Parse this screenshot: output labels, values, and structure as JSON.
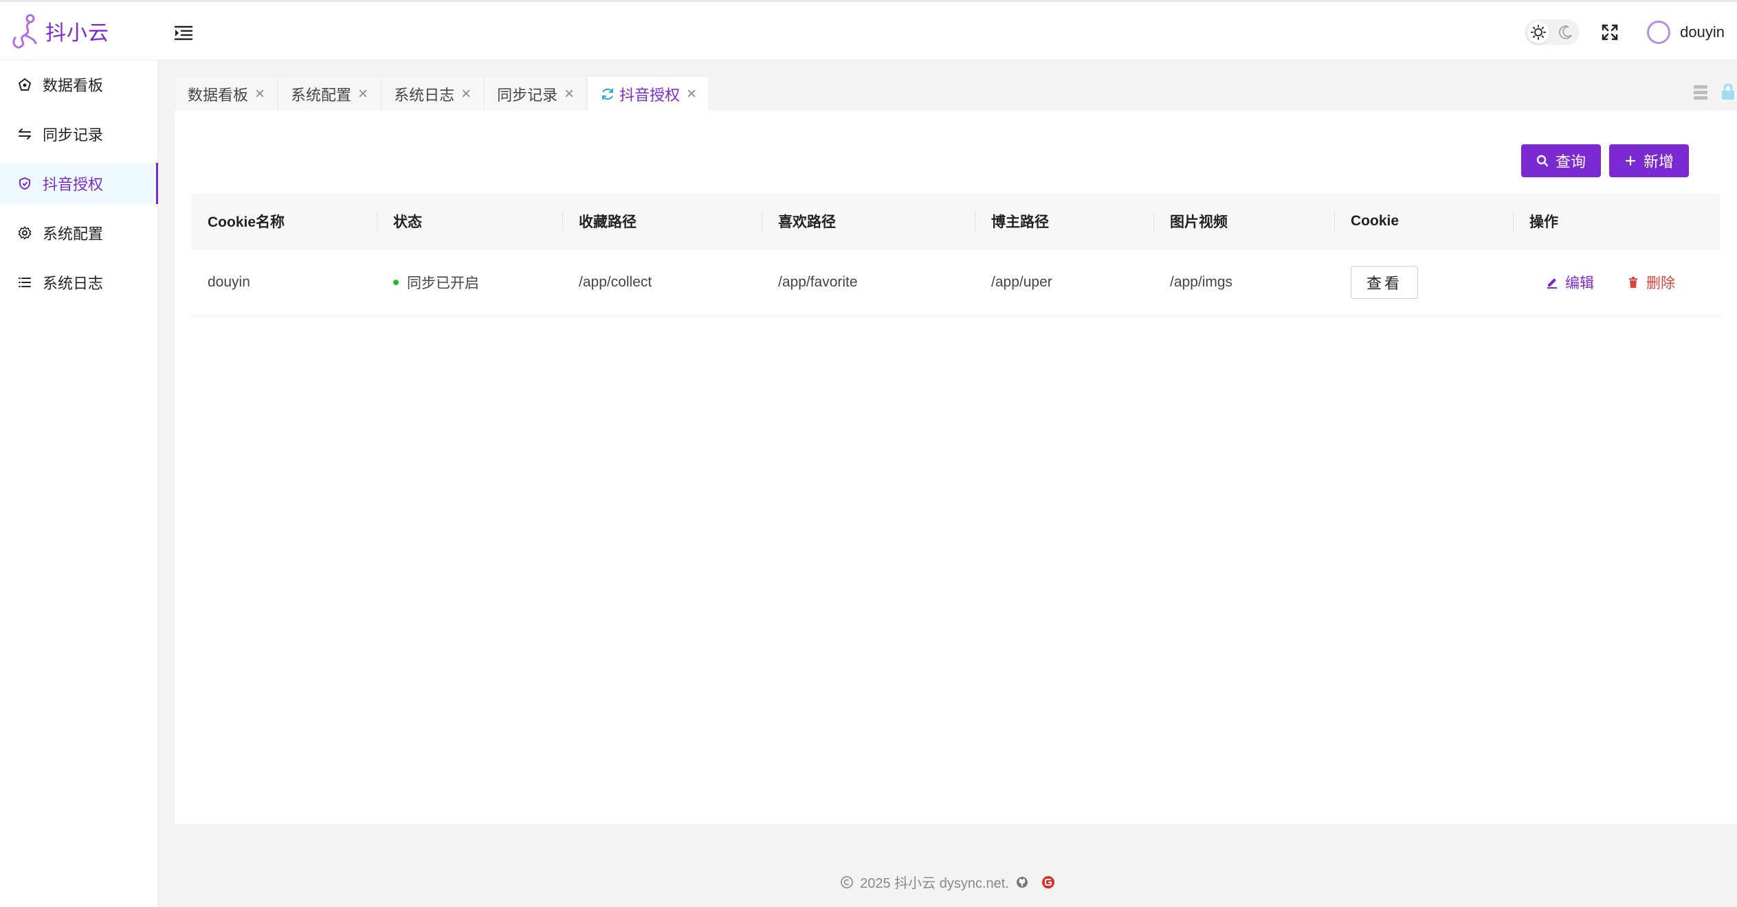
{
  "app": {
    "name": "抖小云"
  },
  "header": {
    "username": "douyin"
  },
  "sidebar": {
    "items": [
      {
        "label": "数据看板",
        "icon": "dashboard-icon"
      },
      {
        "label": "同步记录",
        "icon": "sync-arrows-icon"
      },
      {
        "label": "抖音授权",
        "icon": "shield-icon",
        "active": true
      },
      {
        "label": "系统配置",
        "icon": "gear-icon"
      },
      {
        "label": "系统日志",
        "icon": "list-icon"
      }
    ]
  },
  "tabs": [
    {
      "label": "数据看板"
    },
    {
      "label": "系统配置"
    },
    {
      "label": "系统日志"
    },
    {
      "label": "同步记录"
    },
    {
      "label": "抖音授权",
      "active": true
    }
  ],
  "toolbar": {
    "query_label": "查询",
    "add_label": "新增"
  },
  "table": {
    "headers": [
      "Cookie名称",
      "状态",
      "收藏路径",
      "喜欢路径",
      "博主路径",
      "图片视频",
      "Cookie",
      "操作"
    ],
    "rows": [
      {
        "name": "douyin",
        "status": "同步已开启",
        "collect_path": "/app/collect",
        "favorite_path": "/app/favorite",
        "uper_path": "/app/uper",
        "imgs_path": "/app/imgs",
        "cookie_button": "查看",
        "edit_label": "编辑",
        "delete_label": "删除"
      }
    ]
  },
  "footer": {
    "text": "2025 抖小云 dysync.net."
  },
  "colors": {
    "accent": "#7b2ad1",
    "danger": "#e0433c",
    "status_on": "#2bb62b"
  }
}
